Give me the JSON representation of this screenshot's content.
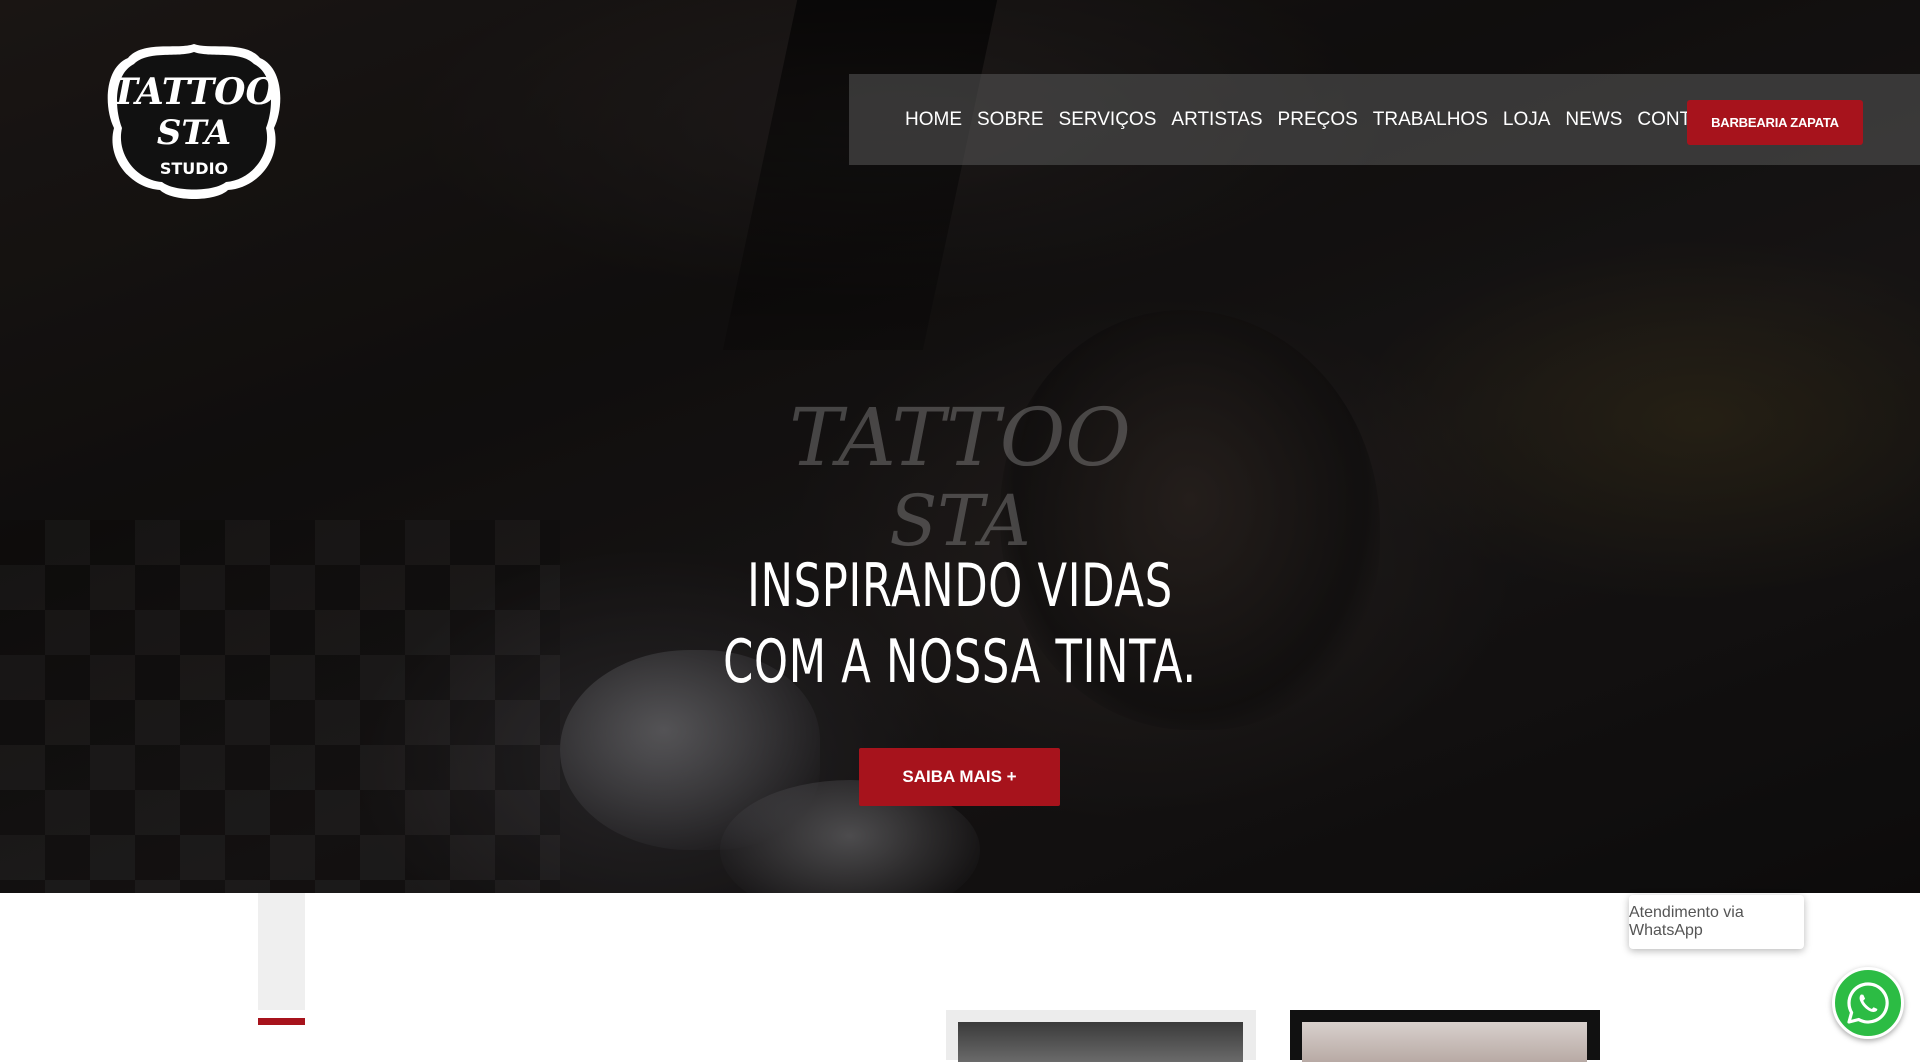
{
  "brand": {
    "logo_text": "TATTOO STA STUDIO",
    "logo_line1": "TATTOO",
    "logo_line2": "STA",
    "logo_line3": "STUDIO",
    "accent_color": "#a7131c"
  },
  "nav": {
    "items": [
      {
        "label": "HOME"
      },
      {
        "label": "SOBRE"
      },
      {
        "label": "SERVIÇOS"
      },
      {
        "label": "ARTISTAS"
      },
      {
        "label": "PREÇOS"
      },
      {
        "label": "TRABALHOS"
      },
      {
        "label": "LOJA"
      },
      {
        "label": "NEWS"
      },
      {
        "label": "CONTATO"
      }
    ],
    "cta_label": "BARBEARIA ZAPATA"
  },
  "hero": {
    "title_line1": "INSPIRANDO VIDAS",
    "title_line2": "COM A NOSSA TINTA.",
    "button_label": "SAIBA MAIS +"
  },
  "whatsapp": {
    "tooltip": "Atendimento via WhatsApp",
    "icon": "whatsapp-icon",
    "color": "#2cbc44"
  }
}
